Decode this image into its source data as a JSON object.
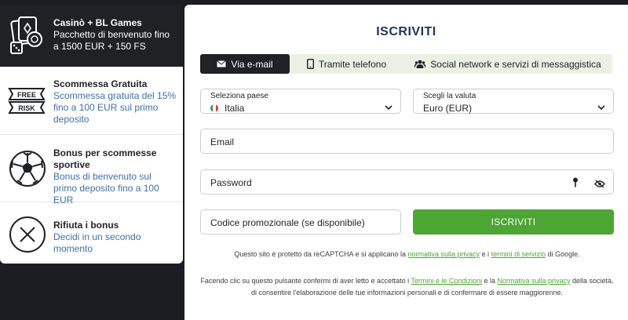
{
  "bonuses": [
    {
      "title": "Casinò + BL Games",
      "desc": "Pacchetto di benvenuto fino a 1500 EUR + 150 FS",
      "icon": "casino-cards-dice-icon"
    },
    {
      "title": "Scommessa Gratuita",
      "desc": "Scommessa gratuita del 15% fino a 100 EUR sul primo deposito",
      "icon": "free-risk-ticket-icon",
      "icon_text": [
        "FREE",
        "RISK"
      ]
    },
    {
      "title": "Bonus per scommesse sportive",
      "desc": "Bonus di benvenuto sul primo deposito fino a 100 EUR",
      "icon": "soccer-ball-icon"
    },
    {
      "title": "Rifiuta i bonus",
      "desc": "Decidi in un secondo momento",
      "icon": "close-circle-icon"
    }
  ],
  "form": {
    "title": "ISCRIVITI",
    "tabs": [
      {
        "label": "Via e-mail",
        "icon": "envelope-icon"
      },
      {
        "label": "Tramite telefono",
        "icon": "phone-icon"
      },
      {
        "label": "Social network e servizi di messaggistica",
        "icon": "users-icon"
      }
    ],
    "country": {
      "label": "Seleziona paese",
      "value": "Italia",
      "icon": "italy-flag-icon"
    },
    "currency": {
      "label": "Scegli la valuta",
      "value": "Euro (EUR)"
    },
    "email": {
      "placeholder": "Email"
    },
    "password": {
      "placeholder": "Password"
    },
    "promo": {
      "placeholder": "Codice promozionale (se disponibile)"
    },
    "submit_label": "ISCRIVITI",
    "recaptcha": {
      "pre": "Questo sito è protetto da reCAPTCHA e si applicano la ",
      "link1": "normativa sulla privacy",
      "mid": " e i ",
      "link2": "termini di servizio",
      "post": " di Google."
    },
    "consent": {
      "pre": "Facendo clic su questo pulsante confermi di aver letto e accettato i ",
      "link1": "Termini e le Condizioni",
      "mid": " e la ",
      "link2": "Normativa sulla privacy",
      "post": " della società, di consentire l'elaborazione delle tue informazioni personali e di confermare di essere maggiorenne."
    }
  },
  "colors": {
    "accent_green": "#4da533",
    "dark": "#1f2124",
    "title_blue": "#1d3557",
    "desc_blue": "#3f6fa8"
  }
}
